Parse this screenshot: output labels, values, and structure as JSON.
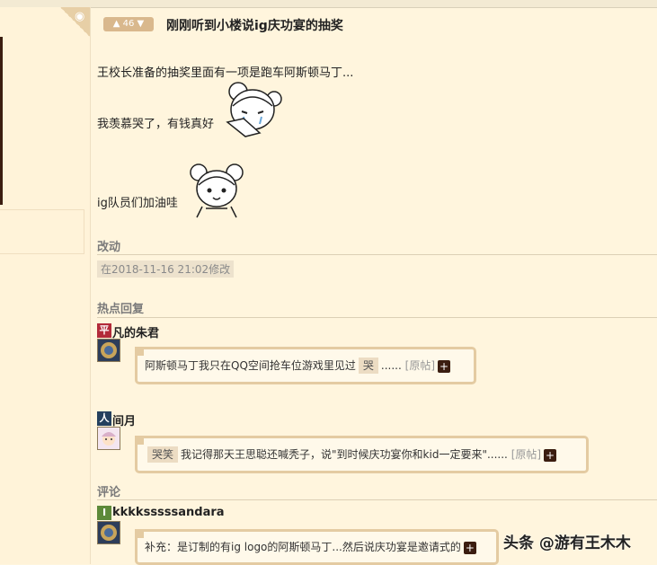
{
  "post": {
    "vote_count": "46",
    "title": "刚刚听到小楼说ig庆功宴的抽奖",
    "lines": [
      "王校长准备的抽奖里面有一项是跑车阿斯顿马丁...",
      "我羡慕哭了，有钱真好",
      "ig队员们加油哇"
    ]
  },
  "edit": {
    "heading": "改动",
    "note": "在2018-11-16 21:02修改"
  },
  "hot_replies": {
    "heading": "热点回复",
    "items": [
      {
        "user_icon_char": "平",
        "user_name": "凡的朱君",
        "text": "阿斯顿马丁我只在QQ空间抢车位游戏里见过",
        "emoticon": "哭",
        "suffix": "......",
        "origin": "[原帖]",
        "plus": "+"
      },
      {
        "user_icon_char": "人",
        "user_name": "间月",
        "emoticon": "哭笑",
        "text": "我记得那天王思聪还喊秃子，说\"到时候庆功宴你和kid一定要来\"......",
        "origin": "[原帖]",
        "plus": "+"
      }
    ]
  },
  "comments": {
    "heading": "评论",
    "items": [
      {
        "user_icon_char": "I",
        "user_name": "kkkksssssandara",
        "text": "补充：是订制的有ig logo的阿斯顿马丁...然后说庆功宴是邀请式的",
        "plus": "+"
      }
    ]
  },
  "watermark": "头条 @游有王木木",
  "colors": {
    "background": "#fff5dd",
    "vote_badge": "#d9b88d",
    "bubble_border": "#e4cba2",
    "dark_button": "#3b1d10",
    "icon_red": "#b22a3a",
    "icon_navy": "#24405e",
    "icon_green": "#5d8a3a"
  }
}
